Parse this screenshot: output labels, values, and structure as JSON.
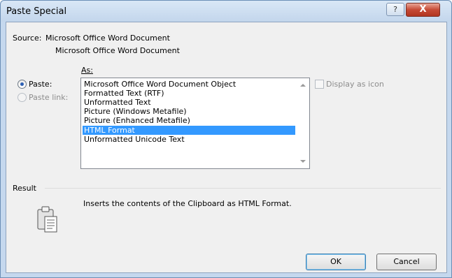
{
  "window": {
    "title": "Paste Special"
  },
  "titlebar_buttons": {
    "help": "?",
    "close": "X"
  },
  "source": {
    "label": "Source:",
    "lines": [
      "Microsoft Office Word Document",
      "Microsoft Office Word Document"
    ]
  },
  "as_label": "As:",
  "paste_options": {
    "paste": {
      "label": "Paste:",
      "selected": true
    },
    "paste_link": {
      "label": "Paste link:",
      "selected": false,
      "disabled": true
    }
  },
  "formats": [
    "Microsoft Office Word Document Object",
    "Formatted Text (RTF)",
    "Unformatted Text",
    "Picture (Windows Metafile)",
    "Picture (Enhanced Metafile)",
    "HTML Format",
    "Unformatted Unicode Text"
  ],
  "selected_format": "HTML Format",
  "display_as_icon": {
    "label": "Display as icon",
    "checked": false,
    "disabled": true
  },
  "result": {
    "label": "Result",
    "text": "Inserts the contents of the Clipboard as HTML Format."
  },
  "buttons": {
    "ok": "OK",
    "cancel": "Cancel"
  }
}
